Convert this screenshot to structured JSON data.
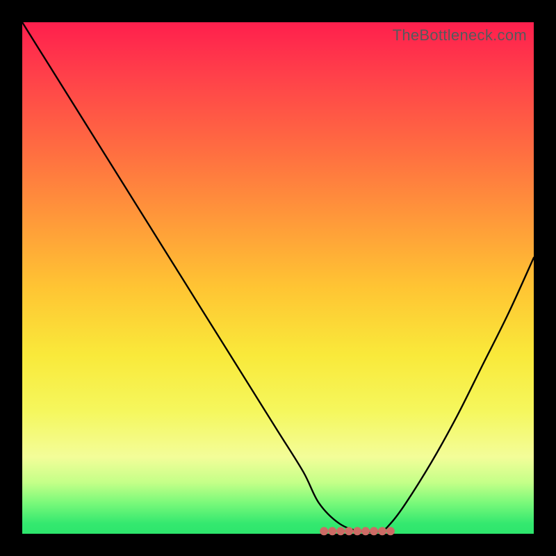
{
  "watermark": "TheBottleneck.com",
  "colors": {
    "frame": "#000000",
    "curve": "#000000",
    "marker": "#cc6b65"
  },
  "chart_data": {
    "type": "line",
    "title": "",
    "xlabel": "",
    "ylabel": "",
    "xlim": [
      0,
      100
    ],
    "ylim": [
      0,
      100
    ],
    "grid": false,
    "note": "Axes and ticks are not rendered; values are read off the plot geometry as percentage of plot width/height. y=0 is green (optimal), y=100 is red (severe bottleneck).",
    "series": [
      {
        "name": "bottleneck-curve",
        "x": [
          0,
          5,
          10,
          15,
          20,
          25,
          30,
          35,
          40,
          45,
          50,
          55,
          58,
          62,
          66,
          70,
          72,
          75,
          80,
          85,
          90,
          95,
          100
        ],
        "y": [
          100,
          92,
          84,
          76,
          68,
          60,
          52,
          44,
          36,
          28,
          20,
          12,
          6,
          2,
          0.5,
          0.5,
          2,
          6,
          14,
          23,
          33,
          43,
          54
        ]
      }
    ],
    "marker_region": {
      "name": "highlight-range",
      "x_start": 59,
      "x_end": 72,
      "y": 0.5
    },
    "gradient_stops": [
      {
        "pos": 0,
        "color": "#ff1f4d"
      },
      {
        "pos": 10,
        "color": "#ff3f4a"
      },
      {
        "pos": 25,
        "color": "#ff6d41"
      },
      {
        "pos": 38,
        "color": "#ff973a"
      },
      {
        "pos": 52,
        "color": "#ffc533"
      },
      {
        "pos": 65,
        "color": "#f9e93a"
      },
      {
        "pos": 76,
        "color": "#f5f75d"
      },
      {
        "pos": 85,
        "color": "#f3fd99"
      },
      {
        "pos": 90,
        "color": "#c4ff88"
      },
      {
        "pos": 94,
        "color": "#79f97a"
      },
      {
        "pos": 98,
        "color": "#34e86f"
      },
      {
        "pos": 100,
        "color": "#2de66c"
      }
    ]
  }
}
